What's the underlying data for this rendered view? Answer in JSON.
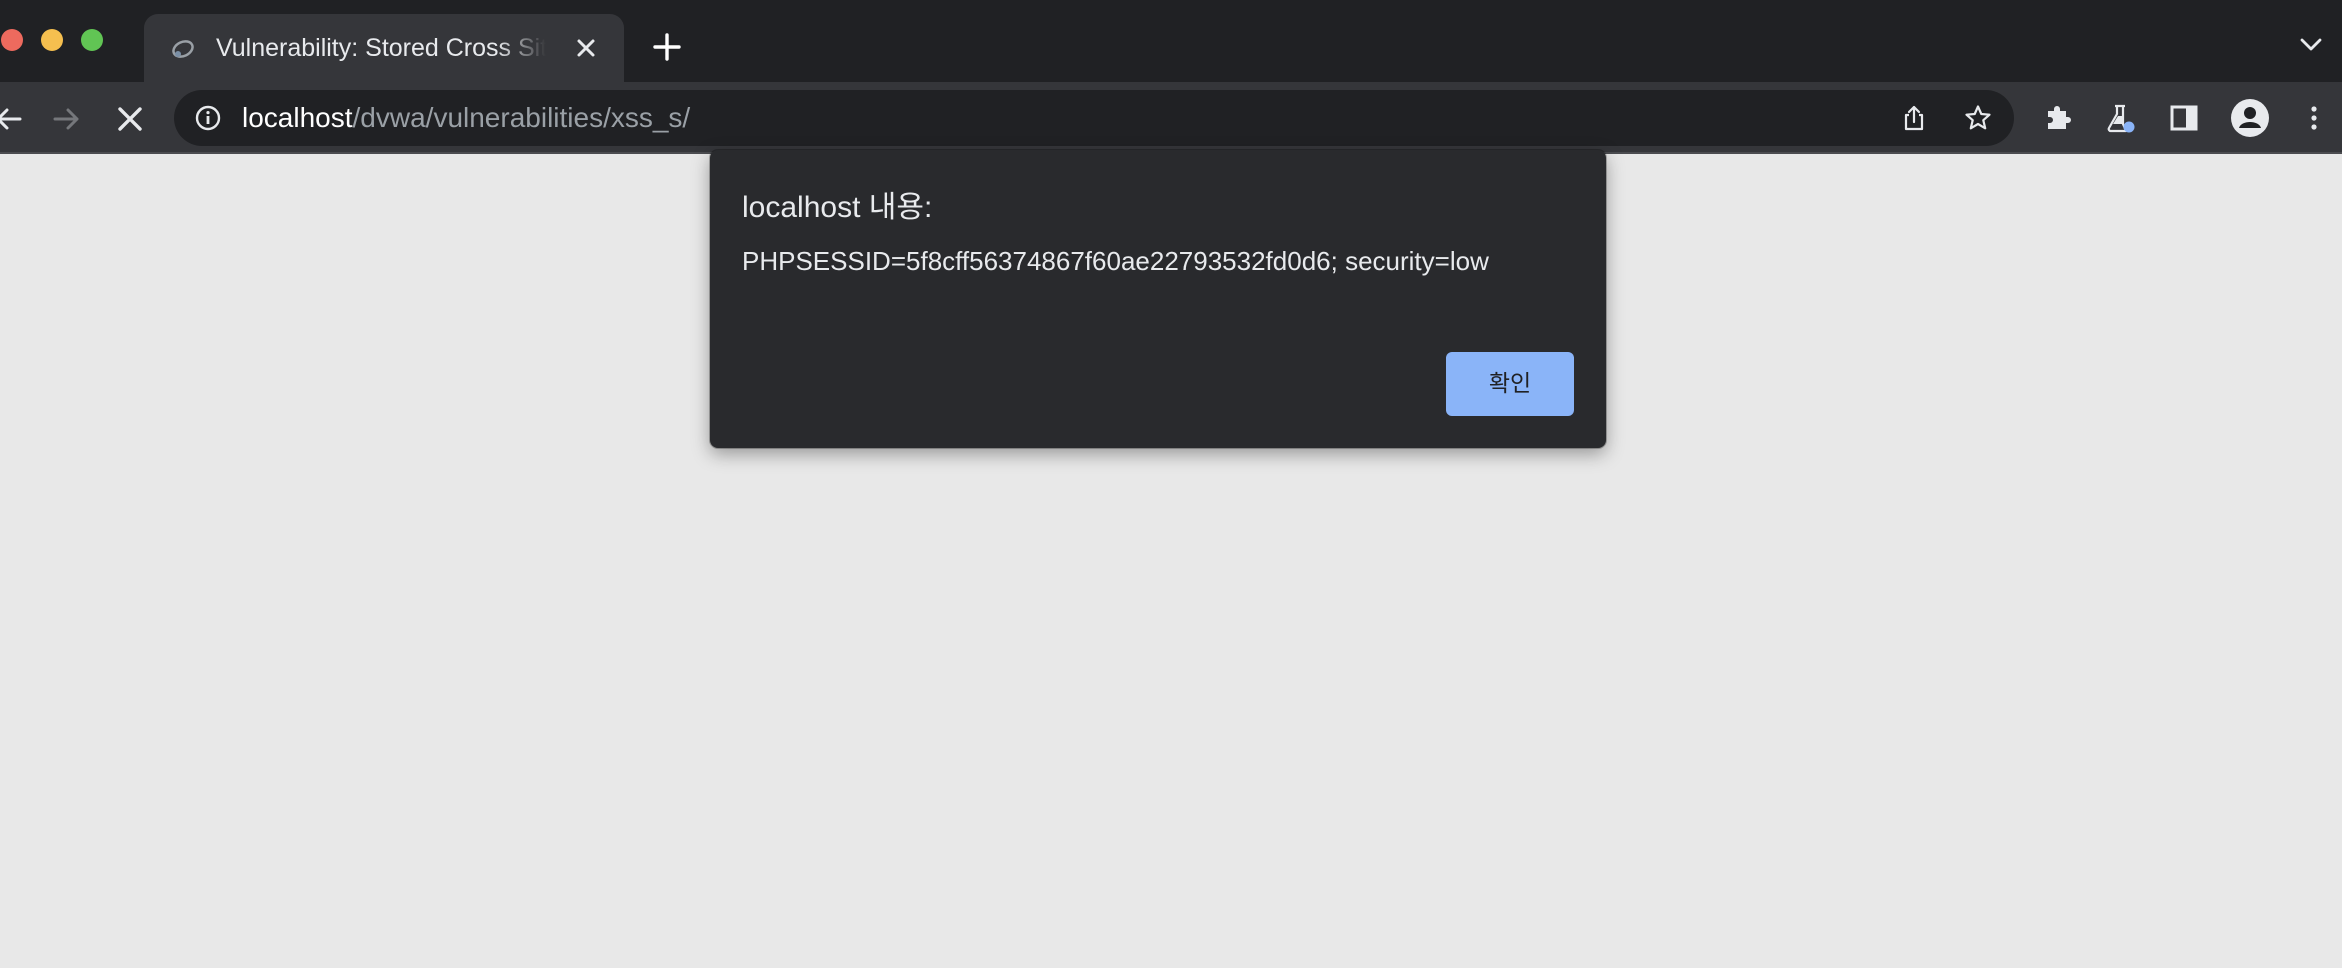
{
  "window": {
    "traffic_lights": [
      "close",
      "minimize",
      "maximize"
    ]
  },
  "tabs": [
    {
      "title": "Vulnerability: Stored Cross Site",
      "favicon": "dvwa-icon",
      "active": true
    }
  ],
  "toolbar": {
    "back_icon": "arrow-left-icon",
    "forward_icon": "arrow-right-icon",
    "stop_icon": "close-icon",
    "address": {
      "security_icon": "info-icon",
      "host": "localhost",
      "path": "/dvwa/vulnerabilities/xss_s/"
    },
    "omnibox_actions": [
      "share-icon",
      "star-icon"
    ],
    "extension_actions": [
      "puzzle-icon",
      "flask-icon",
      "side-panel-icon",
      "profile-icon",
      "more-vert-icon"
    ]
  },
  "dialog": {
    "title": "localhost 내용:",
    "message": "PHPSESSID=5f8cff56374867f60ae22793532fd0d6; security=low",
    "ok_label": "확인"
  },
  "colors": {
    "tabstrip_bg": "#202124",
    "toolbar_bg": "#35363a",
    "page_bg": "#e8e8e8",
    "dialog_bg": "#292a2d",
    "button_accent": "#8ab4f8"
  }
}
